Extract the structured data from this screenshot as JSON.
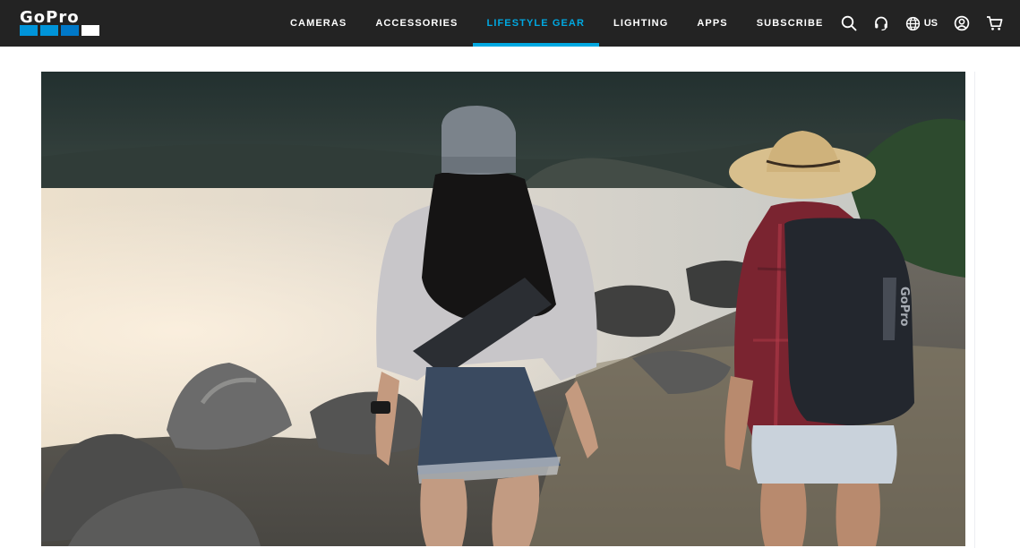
{
  "header": {
    "logo_text": "GoPro",
    "logo_colors": [
      "#0094d9",
      "#0094d9",
      "#0078c8",
      "#ffffff"
    ],
    "accent_color": "#00a8e1",
    "nav": [
      {
        "label": "CAMERAS",
        "active": false
      },
      {
        "label": "ACCESSORIES",
        "active": false
      },
      {
        "label": "LIFESTYLE GEAR",
        "active": true
      },
      {
        "label": "LIGHTING",
        "active": false
      },
      {
        "label": "APPS",
        "active": false
      },
      {
        "label": "SUBSCRIBE",
        "active": false
      }
    ],
    "utilities": {
      "search_icon": "search-icon",
      "support_icon": "headset-icon",
      "region_icon": "globe-icon",
      "region_label": "US",
      "account_icon": "user-circle-icon",
      "cart_icon": "cart-icon"
    }
  },
  "hero": {
    "image": "photo-two-hikers-with-gopro-bags-by-lake",
    "image_label": "GoPro"
  }
}
